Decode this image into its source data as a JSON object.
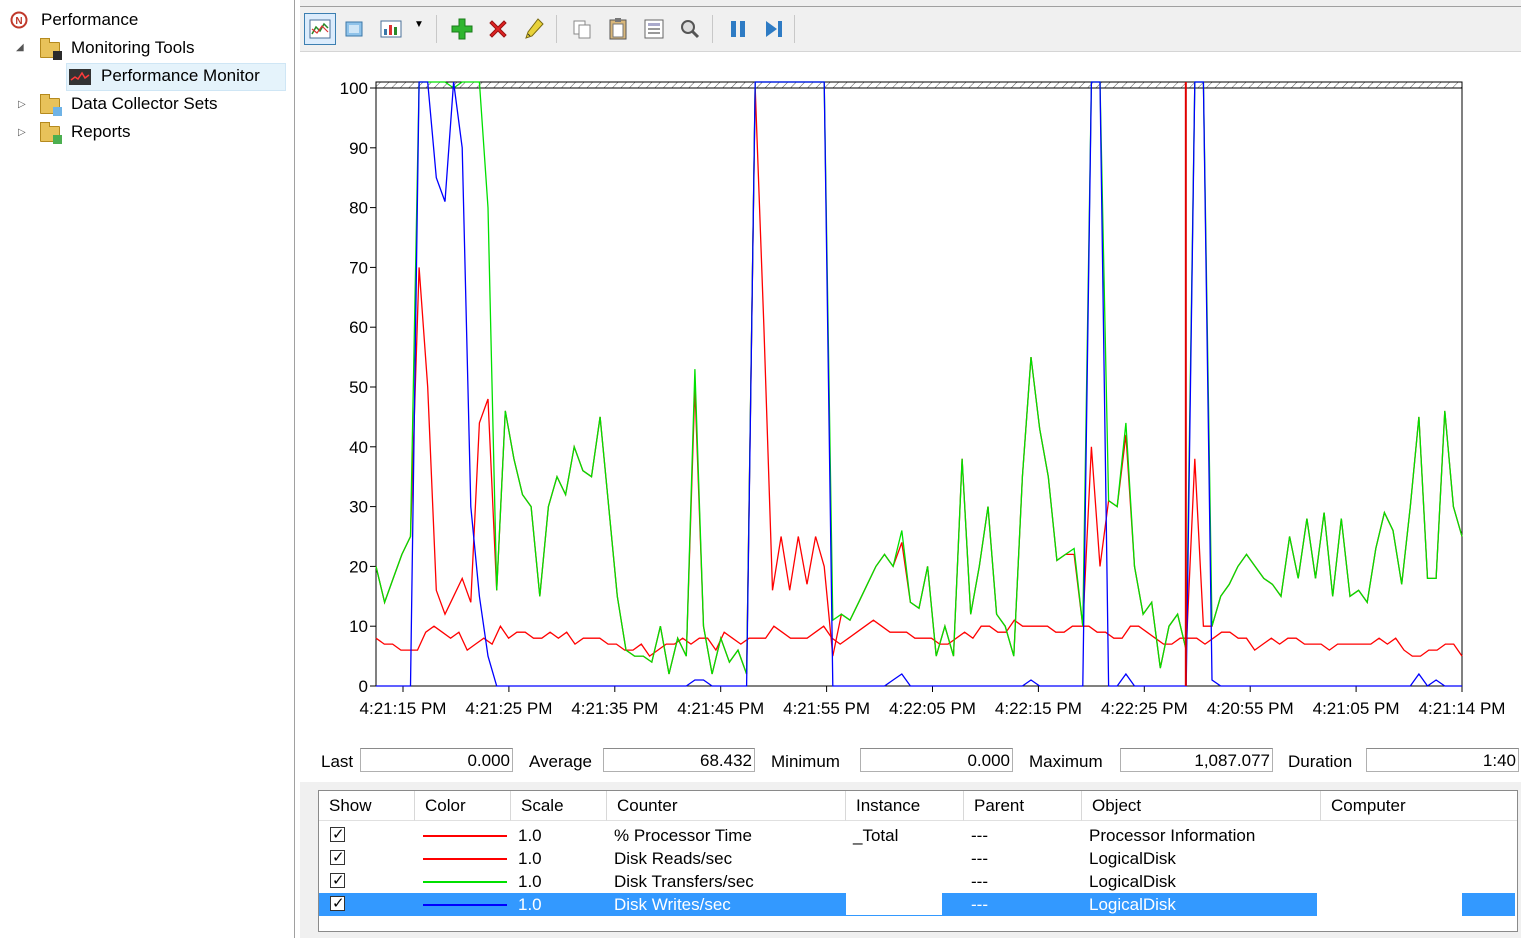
{
  "tree": {
    "root": "Performance",
    "monitoring_tools": "Monitoring Tools",
    "performance_monitor": "Performance Monitor",
    "data_collector_sets": "Data Collector Sets",
    "reports": "Reports"
  },
  "toolbar_icons": [
    "view-graph-icon",
    "freeze-display-icon",
    "change-graph-type-icon",
    "dropdown-icon",
    "add-counter-icon",
    "delete-counter-icon",
    "highlight-icon",
    "copy-properties-icon",
    "paste-counter-list-icon",
    "properties-icon",
    "zoom-icon",
    "pause-icon",
    "update-data-icon"
  ],
  "stats": {
    "last_label": "Last",
    "last_value": "0.000",
    "average_label": "Average",
    "average_value": "68.432",
    "minimum_label": "Minimum",
    "minimum_value": "0.000",
    "maximum_label": "Maximum",
    "maximum_value": "1,087.077",
    "duration_label": "Duration",
    "duration_value": "1:40"
  },
  "legend": {
    "headers": {
      "show": "Show",
      "color": "Color",
      "scale": "Scale",
      "counter": "Counter",
      "instance": "Instance",
      "parent": "Parent",
      "object": "Object",
      "computer": "Computer"
    },
    "rows": [
      {
        "color": "#ff0000",
        "scale": "1.0",
        "counter": "% Processor Time",
        "instance": "_Total",
        "parent": "---",
        "object": "Processor Information"
      },
      {
        "color": "#ff0000",
        "scale": "1.0",
        "counter": "Disk Reads/sec",
        "instance": "",
        "parent": "---",
        "object": "LogicalDisk"
      },
      {
        "color": "#00e000",
        "scale": "1.0",
        "counter": "Disk Transfers/sec",
        "instance": "",
        "parent": "---",
        "object": "LogicalDisk"
      },
      {
        "color": "#0000ff",
        "scale": "1.0",
        "counter": "Disk Writes/sec",
        "instance": "",
        "parent": "---",
        "object": "LogicalDisk"
      }
    ]
  },
  "chart_data": {
    "type": "line",
    "ylim": [
      0,
      100
    ],
    "y_ticks": [
      "0",
      "10",
      "20",
      "30",
      "40",
      "50",
      "60",
      "70",
      "80",
      "90",
      "100"
    ],
    "x_ticks": [
      "4:21:15 PM",
      "4:21:25 PM",
      "4:21:35 PM",
      "4:21:45 PM",
      "4:21:55 PM",
      "4:22:05 PM",
      "4:22:15 PM",
      "4:22:25 PM",
      "4:20:55 PM",
      "4:21:05 PM",
      "4:21:14 PM"
    ],
    "grid": false,
    "series": [
      {
        "name": "% Processor Time",
        "color": "#ff0000",
        "values": [
          8,
          7,
          7,
          6,
          6,
          6,
          9,
          10,
          9,
          8,
          9,
          6,
          7,
          8,
          7,
          10,
          8,
          9,
          9,
          8,
          8,
          9,
          8,
          9,
          7,
          8,
          8,
          8,
          7,
          7,
          6,
          6,
          7,
          5,
          6,
          7,
          7,
          8,
          7,
          8,
          8,
          6,
          9,
          8,
          7,
          8,
          8,
          8,
          10,
          9,
          8,
          8,
          8,
          9,
          10,
          8,
          7,
          8,
          9,
          10,
          11,
          10,
          9,
          9,
          9,
          8,
          8,
          8,
          7,
          7,
          8,
          9,
          8,
          10,
          10,
          9,
          9,
          11,
          10,
          10,
          10,
          10,
          9,
          9,
          10,
          10,
          10,
          9,
          9,
          8,
          8,
          10,
          10,
          9,
          8,
          7,
          7,
          8,
          8,
          8,
          7,
          8,
          9,
          9,
          8,
          8,
          6,
          7,
          8,
          7,
          8,
          8,
          7,
          7,
          7,
          6,
          7,
          7,
          7,
          7,
          7,
          8,
          7,
          8,
          6,
          5,
          5,
          6,
          6,
          7,
          7,
          5
        ]
      },
      {
        "name": "Disk Reads/sec",
        "color": "#ff0000",
        "values": [
          20,
          14,
          18,
          22,
          25,
          70,
          50,
          16,
          12,
          15,
          18,
          14,
          44,
          48,
          16,
          46,
          38,
          32,
          30,
          15,
          30,
          35,
          32,
          40,
          36,
          35,
          45,
          30,
          15,
          6,
          5,
          5,
          4,
          10,
          2,
          8,
          5,
          50,
          10,
          2,
          8,
          4,
          6,
          2,
          100,
          60,
          16,
          25,
          16,
          25,
          17,
          25,
          20,
          5,
          12,
          11,
          14,
          17,
          20,
          22,
          20,
          24,
          14,
          13,
          20,
          5,
          10,
          5,
          38,
          12,
          20,
          30,
          12,
          10,
          5,
          35,
          55,
          43,
          35,
          21,
          22,
          22,
          10,
          40,
          20,
          31,
          30,
          42,
          20,
          12,
          14,
          3,
          10,
          12,
          6,
          38,
          10,
          10,
          15,
          17,
          20,
          22,
          20,
          18,
          17,
          15,
          25,
          18,
          28,
          18,
          29,
          15,
          28,
          15,
          16,
          14,
          23,
          29,
          26,
          17,
          30,
          45,
          18,
          18,
          46,
          30,
          25
        ]
      },
      {
        "name": "Disk Transfers/sec",
        "color": "#00e000",
        "values": [
          20,
          14,
          18,
          22,
          25,
          101,
          101,
          101,
          101,
          100,
          101,
          101,
          101,
          80,
          16,
          46,
          38,
          32,
          30,
          15,
          30,
          35,
          32,
          40,
          36,
          35,
          45,
          30,
          15,
          6,
          5,
          5,
          4,
          10,
          2,
          8,
          5,
          53,
          10,
          2,
          8,
          4,
          6,
          2,
          101,
          101,
          101,
          101,
          101,
          101,
          101,
          101,
          101,
          11,
          12,
          11,
          14,
          17,
          20,
          22,
          20,
          26,
          14,
          13,
          20,
          5,
          10,
          5,
          38,
          12,
          20,
          30,
          12,
          10,
          5,
          35,
          55,
          43,
          35,
          21,
          22,
          23,
          10,
          101,
          101,
          31,
          30,
          44,
          20,
          12,
          14,
          3,
          10,
          12,
          6,
          101,
          101,
          10,
          15,
          17,
          20,
          22,
          20,
          18,
          17,
          15,
          25,
          18,
          28,
          18,
          29,
          15,
          28,
          15,
          16,
          14,
          23,
          29,
          26,
          17,
          30,
          45,
          18,
          18,
          46,
          30,
          25
        ]
      },
      {
        "name": "Disk Writes/sec",
        "color": "#0000ff",
        "values": [
          0,
          0,
          0,
          0,
          0,
          101,
          101,
          85,
          81,
          101,
          90,
          30,
          15,
          5,
          0,
          0,
          0,
          0,
          0,
          0,
          0,
          0,
          0,
          0,
          0,
          0,
          0,
          0,
          0,
          0,
          0,
          0,
          0,
          0,
          0,
          0,
          0,
          1,
          1,
          0,
          0,
          0,
          0,
          0,
          101,
          101,
          101,
          101,
          101,
          101,
          101,
          101,
          101,
          0,
          0,
          0,
          0,
          0,
          0,
          0,
          1,
          2,
          0,
          0,
          0,
          0,
          0,
          0,
          0,
          0,
          0,
          0,
          0,
          0,
          0,
          0,
          1,
          0,
          0,
          0,
          0,
          0,
          0,
          101,
          101,
          0,
          0,
          2,
          0,
          0,
          0,
          0,
          0,
          0,
          0,
          101,
          101,
          1,
          0,
          0,
          0,
          0,
          0,
          0,
          0,
          0,
          0,
          0,
          0,
          0,
          0,
          0,
          0,
          0,
          0,
          0,
          0,
          0,
          0,
          0,
          0,
          2,
          0,
          1,
          0,
          0,
          0
        ]
      }
    ]
  }
}
